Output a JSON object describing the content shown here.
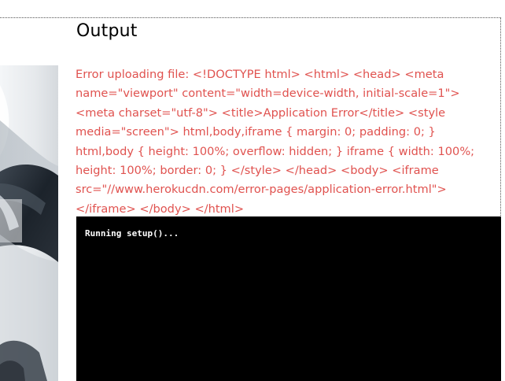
{
  "output": {
    "title": "Output",
    "error_message": "Error uploading file: <!DOCTYPE html> <html> <head> <meta name=\"viewport\" content=\"width=device-width, initial-scale=1\"> <meta charset=\"utf-8\"> <title>Application Error</title> <style media=\"screen\"> html,body,iframe { margin: 0; padding: 0; } html,body { height: 100%; overflow: hidden; } iframe { width: 100%; height: 100%; border: 0; } </style> </head> <body> <iframe src=\"//www.herokucdn.com/error-pages/application-error.html\"></iframe> </body> </html>"
  },
  "console": {
    "line": "Running setup()..."
  },
  "colors": {
    "error_text": "#e0524f",
    "console_background": "#000000",
    "console_text": "#ffffff"
  }
}
